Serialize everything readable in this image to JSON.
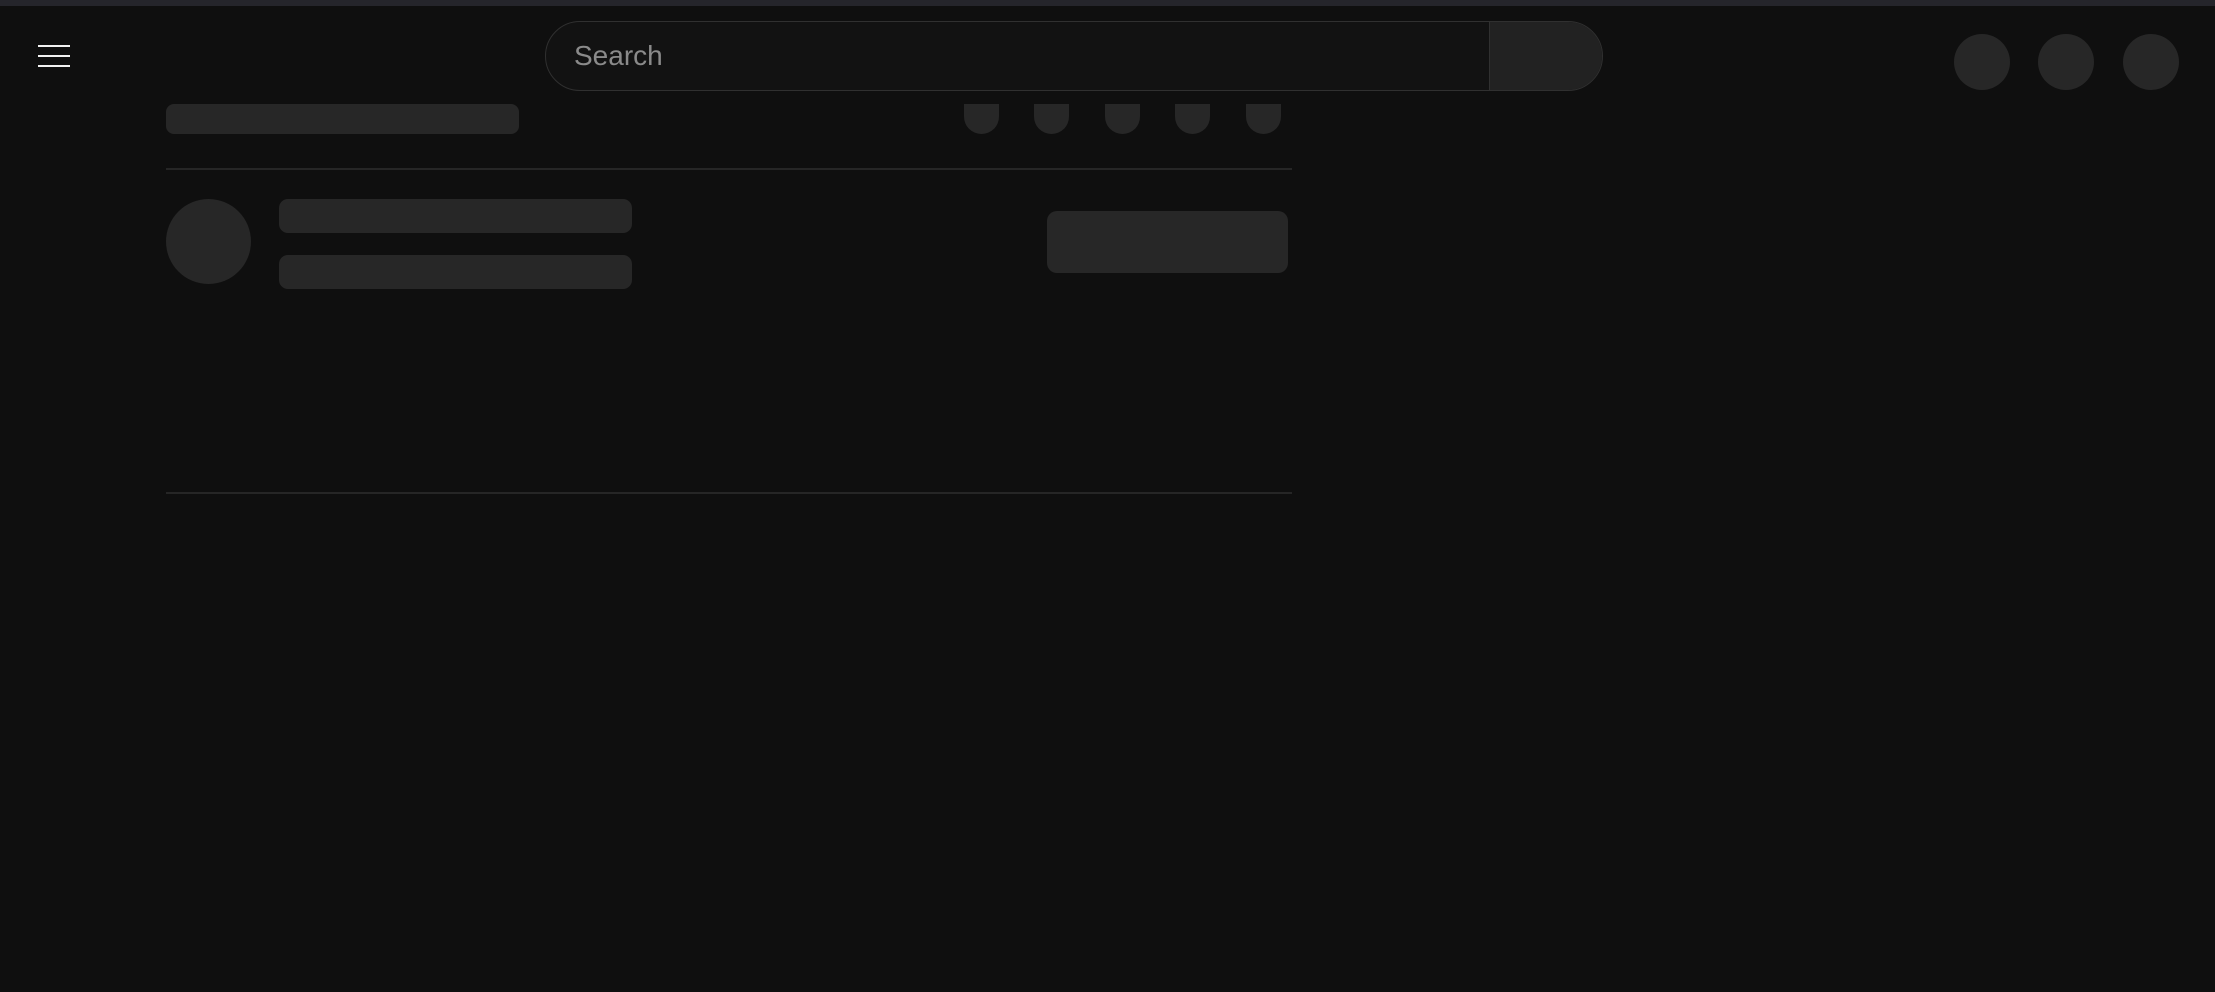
{
  "masthead": {
    "menu_icon": "hamburger-menu-icon",
    "search": {
      "placeholder": "Search",
      "value": ""
    },
    "right_buttons": [
      "placeholder-circle",
      "placeholder-circle",
      "placeholder-circle"
    ]
  },
  "theme": {
    "background": "#0f0f0f",
    "skeleton": "#272727",
    "divider": "#262626",
    "text": "#f1f1f1"
  },
  "state": "loading-skeleton"
}
